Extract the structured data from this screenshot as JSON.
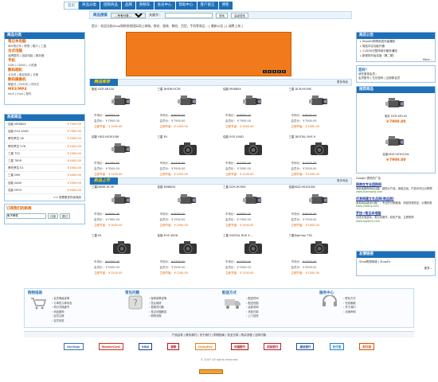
{
  "nav": {
    "items": [
      "首页",
      "商品分类",
      "团购商品",
      "品牌",
      "购物车",
      "会员中心",
      "帮助中心",
      "客户留言",
      "博客"
    ],
    "active_index": 0
  },
  "search": {
    "label": "商品搜索",
    "category_option": "-- 所有分类 --",
    "keyword_label": "关键字：",
    "placeholder": "",
    "search_button": "搜索",
    "advanced_button": "高级搜索"
  },
  "notice": "提示：欢迎光临Shop购物系统国际网上商城，鲜花、服装、数码、百货，手机等商品...  [ 最新公告 ] [ 诚聘上海 ]",
  "categories": {
    "title": "商品分类",
    "groups": [
      {
        "title": "笔记本电脑",
        "sub": "IBM笔记本 | 联想 | 戴尔 | 三星"
      },
      {
        "title": "台式电脑",
        "sub": "品牌整机 | 组装电脑 | 服务器"
      },
      {
        "title": "手机",
        "sub": "GSM | CDMA | 小灵通"
      },
      {
        "title": "数码相机",
        "sub": "卡片机 | 单反相机 | 长焦"
      },
      {
        "title": "数码摄像机",
        "sub": "硬盘式 | DVD式 | 闪存式"
      },
      {
        "title": "MP3/MP4",
        "sub": "mp3 | mp4 | 配件"
      }
    ]
  },
  "hot": {
    "title": "热卖商品",
    "items": [
      {
        "name": "佳能 MV880X",
        "price": "￥7900.00"
      },
      {
        "name": "佳能 EOS 400D",
        "price": "￥7900.00"
      },
      {
        "name": "摩托罗拉 V8",
        "price": "￥2500.00"
      },
      {
        "name": "摩托罗拉 V76",
        "price": "￥4400.00"
      },
      {
        "name": "三星 T33",
        "price": "￥2500.00"
      },
      {
        "name": "三星 T809",
        "price": "￥4400.00"
      },
      {
        "name": "摩托罗拉 E2",
        "price": "￥2500.00"
      },
      {
        "name": "三星 N90",
        "price": "￥4400.00"
      },
      {
        "name": "佳能 A640",
        "price": "￥2500.00"
      },
      {
        "name": "佳能 NP10",
        "price": "￥4400.00"
      }
    ],
    "more": ">> 查看更多热卖商品"
  },
  "subscribe": {
    "title": "订阅我们的新闻",
    "placeholder": "",
    "input_value": "电子邮件",
    "join_button": "订阅",
    "quit_button": "退订"
  },
  "banner": {
    "dots": [
      "1",
      "2",
      "3",
      "4",
      "5"
    ]
  },
  "section1": {
    "tag": "精品推荐",
    "more": "更多商品"
  },
  "section2": {
    "tag": "新品上市",
    "more": "更多商品"
  },
  "price_labels": {
    "market": "市场价：",
    "member": "会员价：",
    "save": "立即节省："
  },
  "grid1": [
    {
      "name": "索尼 DCR-SR100",
      "market": "￥9000.00",
      "member": "￥7900.00",
      "save": "￥1000.00",
      "kind": "camcorder"
    },
    {
      "name": "三星 DHDR-HC3E",
      "market": "￥9000.00",
      "member": "￥7900.00",
      "save": "￥1000.00",
      "kind": "camcorder"
    },
    {
      "name": "佳能 MV880X",
      "market": "￥9000.00",
      "member": "￥7900.00",
      "save": "￥1000.00",
      "kind": "camcorder"
    },
    {
      "name": "三星 DCR-HC90E",
      "market": "￥9000.00",
      "member": "￥7900.00",
      "save": "￥1000.00",
      "kind": "camcorder"
    },
    {
      "name": "佳能 HDZ-HS301SW",
      "market": "￥4700.00",
      "member": "￥3500.00",
      "save": "￥1200.00",
      "kind": "camcorder"
    },
    {
      "name": "三星 R1",
      "market": "￥4700.00",
      "member": "￥3500.00",
      "save": "￥1200.00",
      "kind": "dslr"
    },
    {
      "name": "佳能 EOS 400D",
      "market": "￥4700.00",
      "member": "￥3500.00",
      "save": "￥1200.00",
      "kind": "dslr"
    },
    {
      "name": "三星 DIGITAL RUS 9",
      "market": "￥4700.00",
      "member": "￥3500.00",
      "save": "￥1200.00",
      "kind": "dslr"
    }
  ],
  "grid2": [
    {
      "name": "三星DHDR-HC3E",
      "market": "￥9000.00",
      "member": "￥7900.00",
      "save": "￥1000.00",
      "kind": "camcorder"
    },
    {
      "name": "佳能 MV880X",
      "market": "￥9000.00",
      "member": "￥7900.00",
      "save": "￥1000.00",
      "kind": "camcorder"
    },
    {
      "name": "三星 DCR-HC90E",
      "market": "￥9000.00",
      "member": "￥7900.00",
      "save": "￥1000.00",
      "kind": "camcorder"
    },
    {
      "name": "佳能HDZ-HS301SW",
      "market": "￥9000.00",
      "member": "￥7900.00",
      "save": "￥1000.00",
      "kind": "camcorder"
    },
    {
      "name": "三星 R1",
      "market": "￥4700.00",
      "member": "￥3500.00",
      "save": "￥1200.00",
      "kind": "dslr"
    },
    {
      "name": "佳能 EOS 400D",
      "market": "￥4700.00",
      "member": "￥3500.00",
      "save": "￥1200.00",
      "kind": "dslr"
    },
    {
      "name": "三星 DIGITAL RUS 9...",
      "market": "￥4700.00",
      "member": "￥3500.00",
      "save": "￥1200.00",
      "kind": "dslr"
    },
    {
      "name": "三星Digimax 730",
      "market": "￥4700.00",
      "member": "￥3500.00",
      "save": "￥1200.00",
      "kind": "dslr"
    }
  ],
  "announce": {
    "title": "商店公告",
    "items": [
      "ShopEx购物系统升级通知",
      "商品评论功能开通",
      "11月30日暂停部分服务通知",
      "新规则开始实施（第二期）"
    ],
    "more": "More..."
  },
  "login": {
    "title": "您好！",
    "line1": "请先登录会员...",
    "line2": "会员账号 | 忘记密码 | 注册新会员"
  },
  "recommend": {
    "title": "推荐商品",
    "items": [
      {
        "name": "索尼 DCR-SR100",
        "price": "￥7900.00",
        "kind": "camcorder"
      },
      {
        "name": "佳能HDZ-HS301SW",
        "price": "￥7900.00",
        "kind": "camcorder"
      }
    ]
  },
  "google_ads": {
    "header": "Google 提供的广告",
    "ads": [
      {
        "title": "网商在专业团购网",
        "desc": "消费者团购网站加盟，超低价产品，原装正品，产品均可比价购物",
        "url": "www.tuanwang.com"
      },
      {
        "title": "优易网建立名品网(商品网)",
        "desc": "各类网店建设与推广，专业的分销渠道，商品货源充足，价格优惠",
        "url": "www.yiwang.com"
      },
      {
        "title": "罗技→笔记本电脑",
        "desc": "无线光电鼠标，笔记本配件，精彩产品，立即抢购",
        "url": "www.logitech.com"
      }
    ]
  },
  "friend": {
    "title": "友情链接",
    "body": "Shop购物商城 | ShopEx",
    "more": "更多..."
  },
  "help": [
    {
      "title": "购物指南",
      "items": [
        "会员等级说明",
        "订单的几种状态",
        "积分兑换细节",
        "商品团购",
        "会员注册",
        "会员优惠"
      ]
    },
    {
      "title": "常见问题",
      "items": [
        "保修政策说明",
        "售后保修",
        "退换货问题",
        "常见问题解答",
        "购物流程"
      ]
    },
    {
      "title": "配送方式",
      "items": [
        "配送时间",
        "配送范围",
        "运费说明",
        "货到付款",
        "上门自提"
      ]
    },
    {
      "title": "服务中心",
      "items": [
        "联系方式",
        "在线客服",
        "关于我们",
        "法律声明"
      ]
    }
  ],
  "footer_links": "产品目录 | 联系我们 | 关于我们 | 购物指南 | 安全交易 | 购买流程 | 如何付款",
  "logos": [
    "VeriSign",
    "MasterCard",
    "VISA",
    "银联",
    "ChinaPay",
    "中国银行",
    "招商银行",
    "建设银行",
    "支付宝",
    "财付通"
  ],
  "copyright": "© 2007 All rights reserved"
}
